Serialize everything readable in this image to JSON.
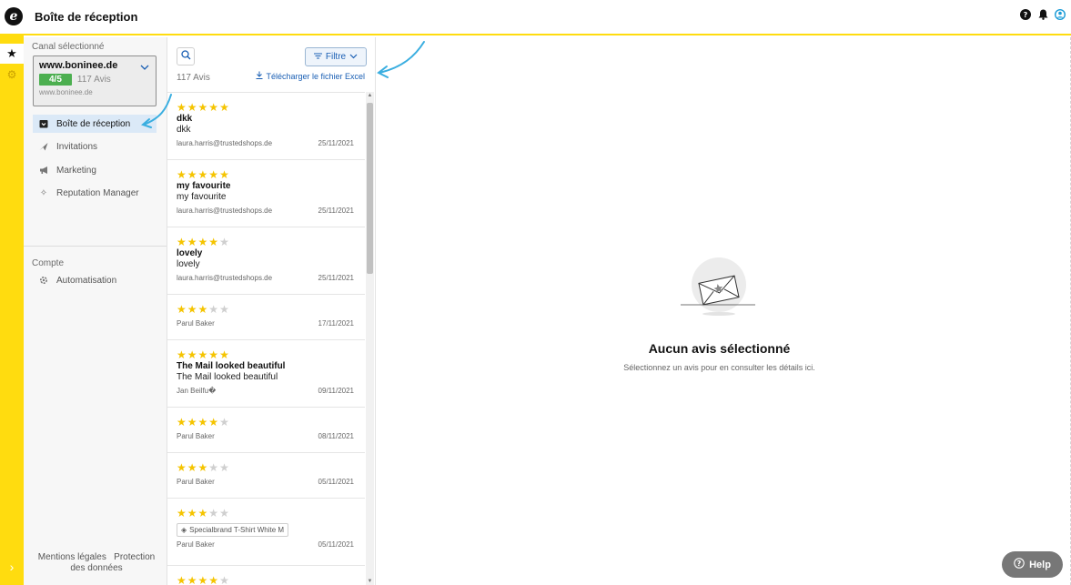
{
  "header": {
    "logo": "e",
    "title": "Boîte de réception"
  },
  "topIcons": [
    "help-icon",
    "bell-icon",
    "user-icon"
  ],
  "rail": {
    "items": [
      "star-icon",
      "gear-icon"
    ],
    "expand": "›"
  },
  "sidebar": {
    "channelLabel": "Canal sélectionné",
    "channel": {
      "name": "www.boninee.de",
      "score": "4/5",
      "count": "117 Avis",
      "url": "www.boninee.de"
    },
    "nav": [
      {
        "label": "Boîte de réception",
        "icon": "inbox-icon"
      },
      {
        "label": "Invitations",
        "icon": "send-icon"
      },
      {
        "label": "Marketing",
        "icon": "megaphone-icon"
      },
      {
        "label": "Reputation Manager",
        "icon": "sparkle-icon"
      }
    ],
    "accountLabel": "Compte",
    "accountNav": [
      {
        "label": "Automatisation",
        "icon": "automation-icon"
      }
    ],
    "footer": {
      "legal": "Mentions légales",
      "privacy": "Protection des données"
    }
  },
  "list": {
    "filter": "Filtre",
    "count": "117 Avis",
    "excel": "Télécharger le fichier Excel",
    "reviews": [
      {
        "rating": 5,
        "title": "dkk",
        "text": "dkk",
        "author": "laura.harris@trustedshops.de",
        "date": "25/11/2021"
      },
      {
        "rating": 5,
        "title": "my favourite",
        "text": "my favourite",
        "author": "laura.harris@trustedshops.de",
        "date": "25/11/2021"
      },
      {
        "rating": 4,
        "title": "lovely",
        "text": "lovely",
        "author": "laura.harris@trustedshops.de",
        "date": "25/11/2021"
      },
      {
        "rating": 3,
        "title": "",
        "text": "",
        "author": "Parul Baker",
        "date": "17/11/2021"
      },
      {
        "rating": 5,
        "title": "The Mail looked beautiful",
        "text": "The Mail looked beautiful",
        "author": "Jan Beilfu�",
        "date": "09/11/2021"
      },
      {
        "rating": 4,
        "title": "",
        "text": "",
        "author": "Parul Baker",
        "date": "08/11/2021"
      },
      {
        "rating": 3,
        "title": "",
        "text": "",
        "author": "Parul Baker",
        "date": "05/11/2021"
      },
      {
        "rating": 3,
        "title": "",
        "text": "",
        "product": "Specialbrand T-Shirt White M",
        "author": "Parul Baker",
        "date": "05/11/2021"
      },
      {
        "rating": 4,
        "title": "",
        "text": "",
        "author": "",
        "date": ""
      }
    ]
  },
  "detail": {
    "emptyTitle": "Aucun avis sélectionné",
    "emptySub": "Sélectionnez un avis pour en consulter les détails ici."
  },
  "help": "Help",
  "colors": {
    "accent": "#ffdc0f",
    "link": "#1a5fb4",
    "star": "#f5c400",
    "score": "#4caf50",
    "arrow": "#3aaee0"
  }
}
